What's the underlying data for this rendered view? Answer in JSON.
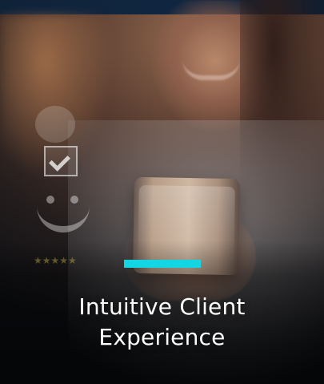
{
  "card": {
    "title_line_1": "Intuitive Client",
    "title_line_2": "Experience",
    "accent_color": "#12d6e3"
  },
  "overlay_icons": {
    "bubble_icon": "chat-bubble-icon",
    "checkbox_icon": "check-icon",
    "smiley_icon": "smiley-face-icon",
    "rating_icon": "star-rating-icon",
    "rating_stars": "★★★★★"
  }
}
